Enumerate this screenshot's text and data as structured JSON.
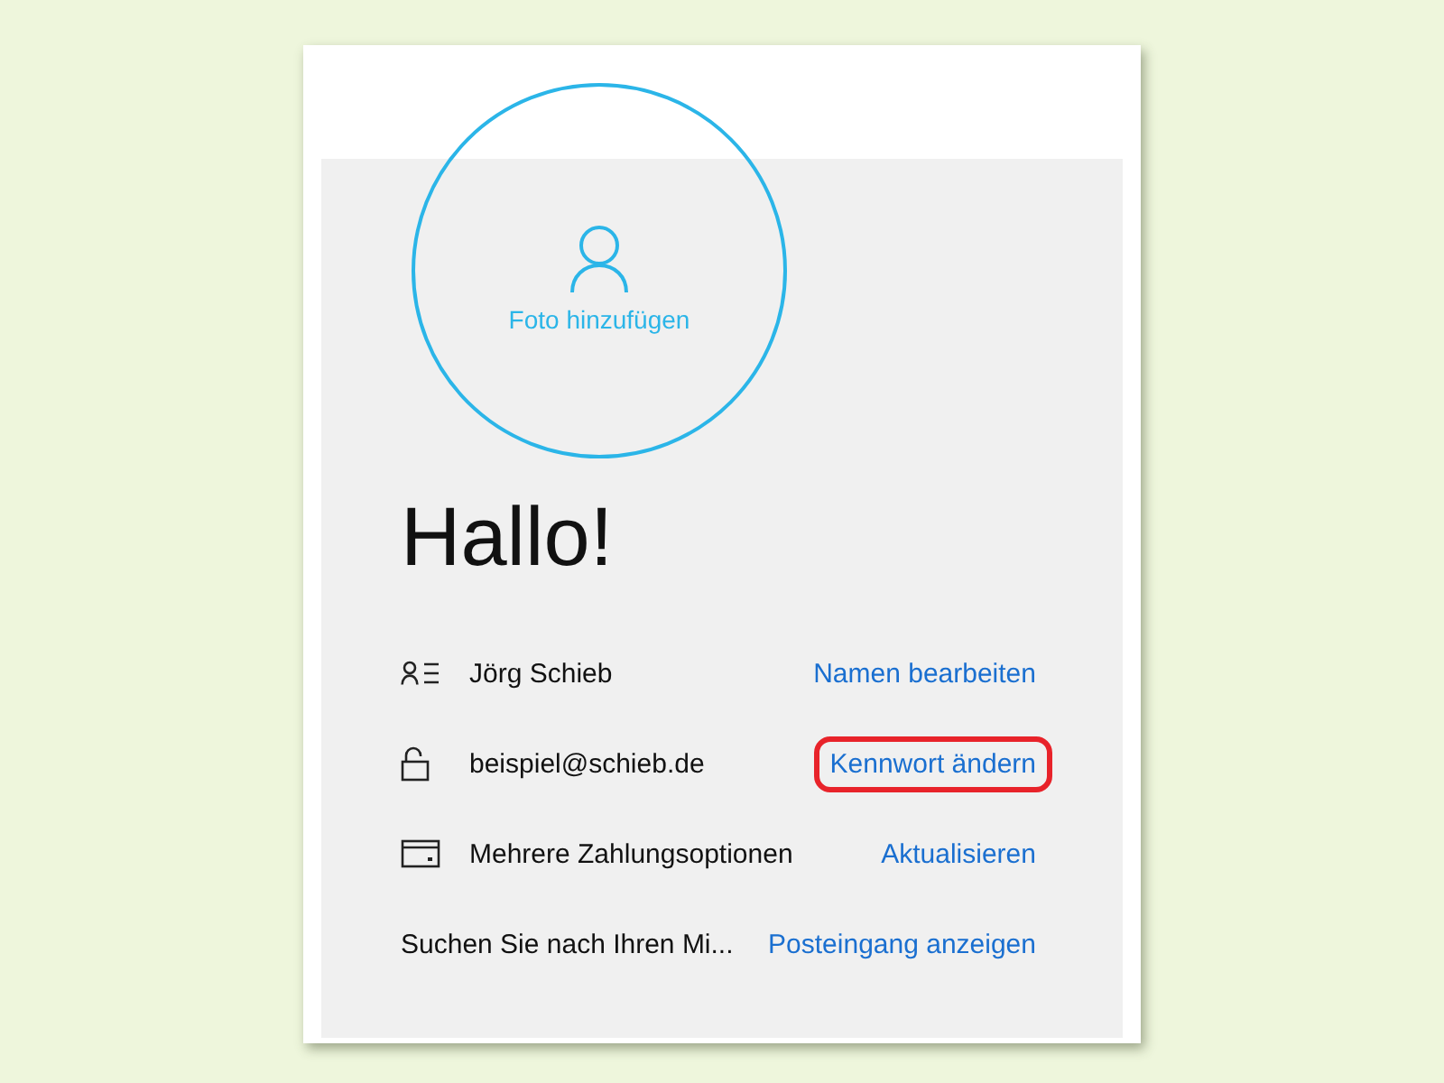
{
  "photo": {
    "label": "Foto hinzufügen"
  },
  "greeting": "Hallo!",
  "rows": [
    {
      "kind": "person",
      "label": "Jörg Schieb",
      "action": "Namen bearbeiten",
      "highlighted": false
    },
    {
      "kind": "lock",
      "label": "beispiel@schieb.de",
      "action": "Kennwort ändern",
      "highlighted": true
    },
    {
      "kind": "card",
      "label": "Mehrere Zahlungsoptionen",
      "action": "Aktualisieren",
      "highlighted": false
    },
    {
      "kind": "text",
      "label": "Suchen Sie nach Ihren Mi...",
      "action": "Posteingang anzeigen",
      "highlighted": false
    }
  ]
}
